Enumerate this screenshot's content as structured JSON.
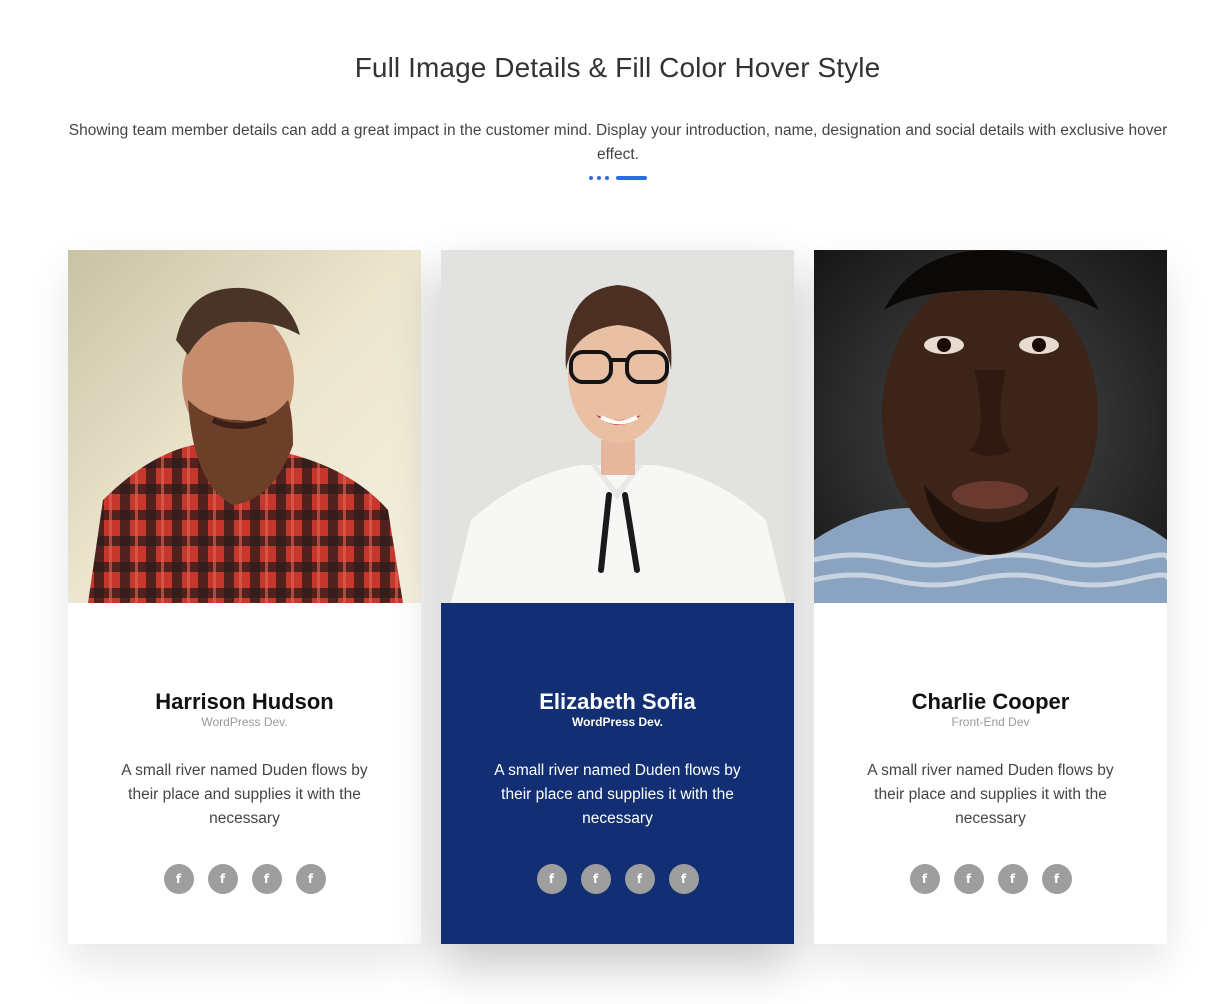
{
  "header": {
    "title": "Full Image Details & Fill Color Hover Style",
    "description": "Showing team member details can add a great impact in the customer mind. Display your introduction, name, designation and social details with exclusive hover effect."
  },
  "colors": {
    "accent": "#2a6fe0",
    "active_fill": "#132f74",
    "social_bg": "#9e9e9e"
  },
  "members": [
    {
      "name": "Harrison Hudson",
      "role": "WordPress Dev.",
      "bio": "A small river named Duden flows by their place and supplies it with the necessary",
      "socials": [
        "facebook-icon",
        "facebook-icon",
        "facebook-icon",
        "facebook-icon"
      ],
      "social_glyph": "f",
      "active": false
    },
    {
      "name": "Elizabeth Sofia",
      "role": "WordPress Dev.",
      "bio": "A small river named Duden flows by their place and supplies it with the necessary",
      "socials": [
        "facebook-icon",
        "facebook-icon",
        "facebook-icon",
        "facebook-icon"
      ],
      "social_glyph": "f",
      "active": true
    },
    {
      "name": "Charlie Cooper",
      "role": "Front-End Dev",
      "bio": "A small river named Duden flows by their place and supplies it with the necessary",
      "socials": [
        "facebook-icon",
        "facebook-icon",
        "facebook-icon",
        "facebook-icon"
      ],
      "social_glyph": "f",
      "active": false
    }
  ]
}
